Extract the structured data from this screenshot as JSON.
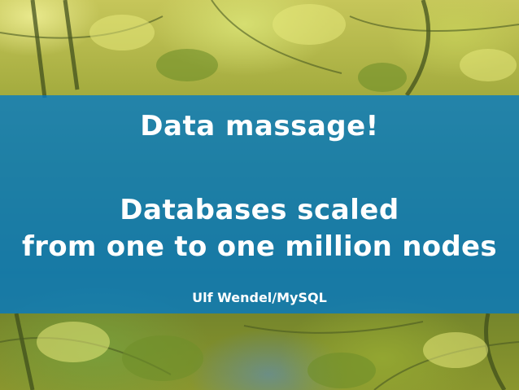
{
  "slide": {
    "title": "Data massage!",
    "subtitle_line1": "Databases scaled",
    "subtitle_line2": "from one to one million nodes",
    "author": "Ulf Wendel/MySQL"
  },
  "colors": {
    "band": "#0078c8",
    "text": "#ffffff",
    "foliage": "#8d9a2c"
  },
  "background": {
    "description_icon": "leaf-photo-background"
  }
}
